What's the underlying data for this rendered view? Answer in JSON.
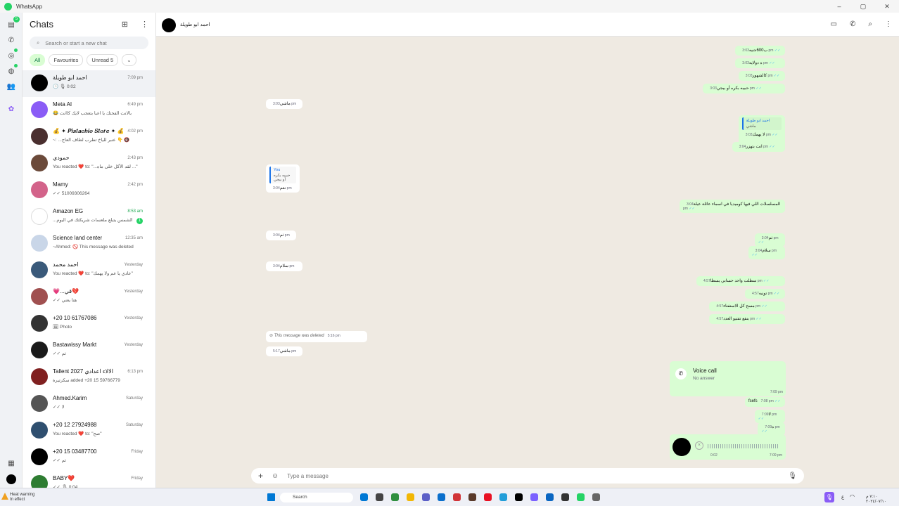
{
  "window": {
    "title": "WhatsApp",
    "controls": [
      "–",
      "▢",
      "✕"
    ]
  },
  "rail": {
    "chats_badge": "5"
  },
  "sidebar": {
    "title": "Chats",
    "search_placeholder": "Search or start a new chat",
    "filters": [
      "All",
      "Favourites",
      "Unread 5",
      "⌄"
    ],
    "chats": [
      {
        "name": "احمد ابو طويلة",
        "time": "7:09 pm",
        "preview": "🕓 🎙 0:02",
        "avatar": "#000000",
        "active": true
      },
      {
        "name": "Meta AI",
        "time": "6:49 pm",
        "preview": "😂 بالانت الفحتك يا اعبا بتعجب لايك كاانت",
        "avatar": "#8a5cf6"
      },
      {
        "name": "💰 ✦ 𝑷𝒊𝒔𝒕𝒂𝒄𝒉𝒊𝒐 𝑺𝒕𝒐𝒓𝒆 ✦ 💰",
        "time": "4:02 pm",
        "preview": "~: ...عنبر للياخ تطرب لطاف العاج 👇 🔇",
        "avatar": "#4a2f2f"
      },
      {
        "name": "حمودي",
        "time": "2:43 pm",
        "preview": "You reacted ❤️ to: \"...لقد الأكل خلى ماه ...\"",
        "avatar": "#6b4a3a"
      },
      {
        "name": "Mamy",
        "time": "2:42 pm",
        "preview": "✓✓ 51009306264",
        "avatar": "#d3638a"
      },
      {
        "name": "Amazon EG",
        "time": "8:53 am",
        "preview": "...الشمس يتبلع ملعسات شريكتك في اليوم",
        "avatar": "#ffffff",
        "unread": "1",
        "time_green": true
      },
      {
        "name": "Science land center",
        "time": "12:35 am",
        "preview": "~Ahmed: 🚫 This message was deleted",
        "avatar": "#c9d6e8"
      },
      {
        "name": "احمد محمد",
        "time": "Yesterday",
        "preview": "You reacted ❤️ to: \"عادي يا عم ولا يهمك\"",
        "avatar": "#3a5a7a"
      },
      {
        "name": "💗...قي💔",
        "time": "Yesterday",
        "preview": "✓✓ هنا يعني",
        "avatar": "#a05050"
      },
      {
        "name": "+20 10 61767086",
        "time": "Yesterday",
        "preview": "🖼 Photo",
        "avatar": "#333333"
      },
      {
        "name": "Bastawissy Markt",
        "time": "Yesterday",
        "preview": "✓✓ ثم",
        "avatar": "#1a1a1a"
      },
      {
        "name": "Tallent 2027 الالاء اعدادي",
        "time": "6:13 pm",
        "preview": "سكرتيرة added +20 15 59766779",
        "avatar": "#802020"
      },
      {
        "name": "Ahmed.Karim",
        "time": "Saturday",
        "preview": "✓✓ لا",
        "avatar": "#555555"
      },
      {
        "name": "+20 12 27924988",
        "time": "Saturday",
        "preview": "You reacted ❤️ to: \"صح\"",
        "avatar": "#2f4f6f"
      },
      {
        "name": "+20 15 03487700",
        "time": "Friday",
        "preview": "✓✓ ثم",
        "avatar": "#000000"
      },
      {
        "name": "BABY❤️",
        "time": "Friday",
        "preview": "✓✓ 🎙 0:04",
        "avatar": "#2e7d32"
      }
    ]
  },
  "chat": {
    "contact_name": "احمد ابو طويلة",
    "messages": [
      {
        "dir": "out",
        "text": "ب600جنيه",
        "time": "3:03 pm"
      },
      {
        "dir": "out",
        "text": "ه دولايه",
        "time": "3:03 pm"
      },
      {
        "dir": "out",
        "text": "كالشهور",
        "time": "3:03 pm"
      },
      {
        "dir": "out",
        "text": "حبيبه بكره أو بيجي",
        "time": "3:03 pm"
      },
      {
        "dir": "in",
        "text": "ماشي",
        "time": "3:03 pm"
      },
      {
        "dir": "out",
        "text": "لا يهمك",
        "time": "3:03 pm",
        "quote_name": "احمد ابو طويلة",
        "quote_text": "ماشي"
      },
      {
        "dir": "out",
        "text": "انت بتهزر",
        "time": "3:04 pm"
      },
      {
        "dir": "in",
        "text": "نعم",
        "time": "3:04 pm",
        "quote_name": "You",
        "quote_text": "حبيبه بكره أو بيجي"
      },
      {
        "dir": "out",
        "text": "المسلسلات اللي فيها كوميديا في اسماء عائلة عيلة",
        "time": "3:04 pm"
      },
      {
        "dir": "in",
        "text": "ثم",
        "time": "3:04 pm"
      },
      {
        "dir": "out",
        "text": "ثم",
        "time": "3:04 pm"
      },
      {
        "dir": "out",
        "text": "سلام",
        "time": "3:04 pm"
      },
      {
        "dir": "in",
        "text": "سلام",
        "time": "3:04 pm"
      },
      {
        "dir": "out",
        "text": "سطلت واحد حسابي يسطا",
        "time": "4:57 pm"
      },
      {
        "dir": "out",
        "text": "تونيه",
        "time": "4:57 pm"
      },
      {
        "dir": "out",
        "text": "مسح كل الاستفتاء",
        "time": "4:57 pm"
      },
      {
        "dir": "out",
        "text": "بنفع تفتيو العدد",
        "time": "4:57 pm"
      },
      {
        "dir": "in",
        "text": "This message was deleted",
        "time": "5:16 pm"
      },
      {
        "dir": "in",
        "text": "ماشي",
        "time": "5:17 pm"
      },
      {
        "dir": "out",
        "text": "fsefs",
        "time": "7:08 pm"
      },
      {
        "dir": "out",
        "text": "لا",
        "time": "7:09 pm"
      },
      {
        "dir": "out",
        "text": "ه",
        "time": "7:09 pm"
      }
    ],
    "voice_call": {
      "title": "Voice call",
      "subtitle": "No answer",
      "time": "7:09 pm"
    },
    "voice_note": {
      "duration": "0:02",
      "time": "7:09 pm"
    },
    "composer_placeholder": "Type a message"
  },
  "taskbar": {
    "warning_title": "Heat warning",
    "warning_sub": "In effect",
    "search_label": "Search",
    "lang": "ع",
    "clock_time": "٧:١٠ م",
    "clock_date": "٢٠٢٤/٠٧/١٠",
    "apps": [
      "#0078d4",
      "#444444",
      "#2f8f3f",
      "#f2b705",
      "#5b5fc7",
      "#0b6fcc",
      "#d13438",
      "#5a3a2a",
      "#e81123",
      "#229ed9",
      "#000000",
      "#7b61ff",
      "#0a66c2",
      "#333333",
      "#25d366",
      "#666666"
    ]
  }
}
